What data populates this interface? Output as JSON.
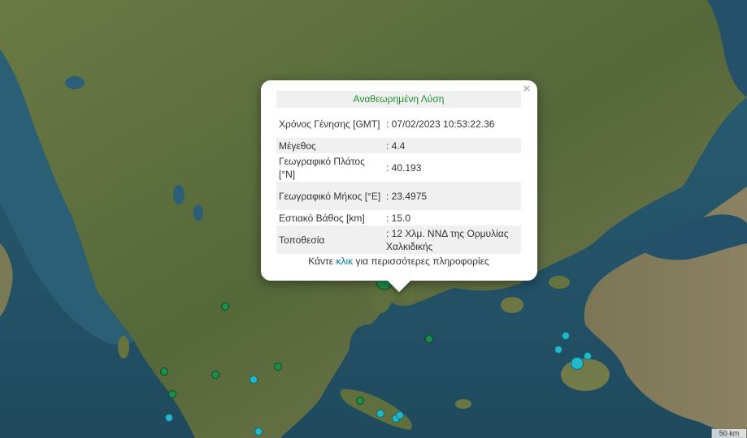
{
  "colors": {
    "sea": "#2c5a6e",
    "land": "#5a6b3c",
    "marker_green": "#1e8c4a",
    "marker_cyan": "#22b8c9",
    "title_green": "#1f8f2f",
    "link_blue": "#0078a8"
  },
  "popup": {
    "close_symbol": "×",
    "title": "Αναθεωρημένη Λύση",
    "rows": [
      {
        "label": "Χρόνος Γένησης [GMT]",
        "value": ": 07/02/2023 10:53:22.36"
      },
      {
        "label": "Μέγεθος",
        "value": ": 4.4"
      },
      {
        "label": "Γεωγραφικό Πλάτος [°N]",
        "value": ": 40.193"
      },
      {
        "label": "Γεωγραφικό Μήκος [°E]",
        "value": ": 23.4975"
      },
      {
        "label": "Εστιακό Βάθος [km]",
        "value": ": 15.0"
      },
      {
        "label": "Τοποθεσία",
        "value": ": 12 Χλμ. ΝΝΔ της Ορμυλίας Χαλκιδικής"
      }
    ],
    "more_prefix": "Κάντε ",
    "more_link": "κλικ",
    "more_suffix": " για περισσότερες πληροφορίες"
  },
  "scale": {
    "label": "50 km"
  }
}
